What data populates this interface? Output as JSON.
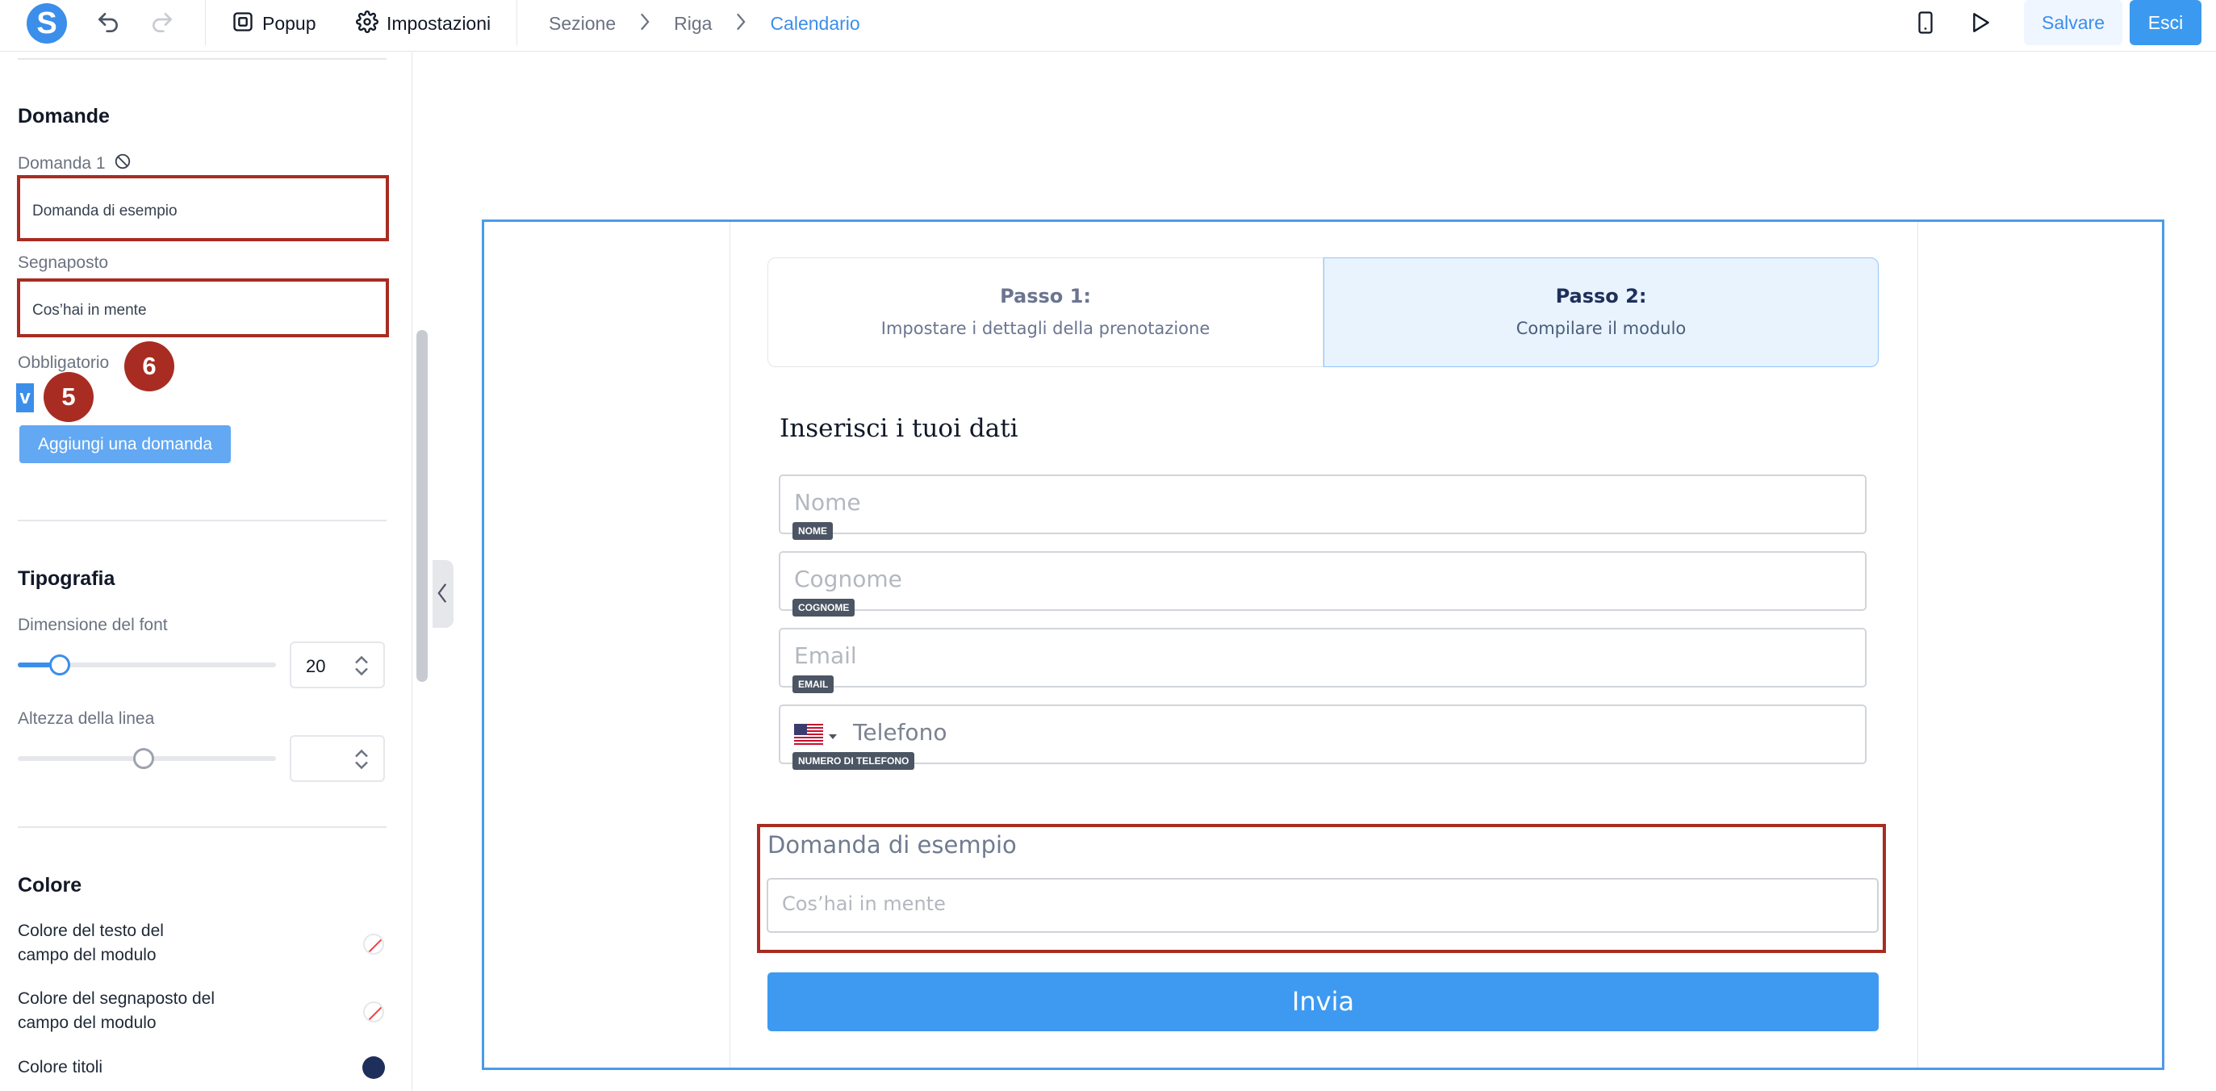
{
  "topbar": {
    "logo_letter": "S",
    "popup_label": "Popup",
    "settings_label": "Impostazioni",
    "breadcrumb": [
      "Sezione",
      "Riga",
      "Calendario"
    ],
    "save_label": "Salvare",
    "exit_label": "Esci"
  },
  "sidebar": {
    "questions_title": "Domande",
    "question1_label": "Domanda 1",
    "question1_value": "Domanda di esempio",
    "placeholder_label": "Segnaposto",
    "placeholder_value": "Cos’hai in mente",
    "required_label": "Obbligatorio",
    "required_checkbox_char": "v",
    "marker_6": "6",
    "marker_5": "5",
    "add_question_label": "Aggiungi una domanda",
    "typography_title": "Tipografia",
    "font_size_label": "Dimensione del font",
    "font_size_value": "20",
    "line_height_label": "Altezza della linea",
    "line_height_value": "",
    "color_title": "Colore",
    "color_field_text_label": "Colore del testo del campo del modulo",
    "color_field_placeholder_label": "Colore del segnaposto del campo del modulo",
    "color_titles_label": "Colore titoli",
    "color_titles_value": "#1e2f5c"
  },
  "form": {
    "step1_title": "Passo 1:",
    "step1_subtitle": "Impostare i dettagli della prenotazione",
    "step2_title": "Passo 2:",
    "step2_subtitle": "Compilare il modulo",
    "heading": "Inserisci i tuoi dati",
    "fields": [
      {
        "placeholder": "Nome",
        "badge": "NOME"
      },
      {
        "placeholder": "Cognome",
        "badge": "COGNOME"
      },
      {
        "placeholder": "Email",
        "badge": "EMAIL"
      },
      {
        "placeholder": "Telefono",
        "badge": "NUMERO DI TELEFONO"
      }
    ],
    "custom_question_label": "Domanda di esempio",
    "custom_question_placeholder": "Cos’hai in mente",
    "submit_label": "Invia"
  },
  "colors": {
    "accent": "#3b8eea",
    "highlight_red": "#a82c22",
    "step_active_bg": "#e8f3fd"
  }
}
